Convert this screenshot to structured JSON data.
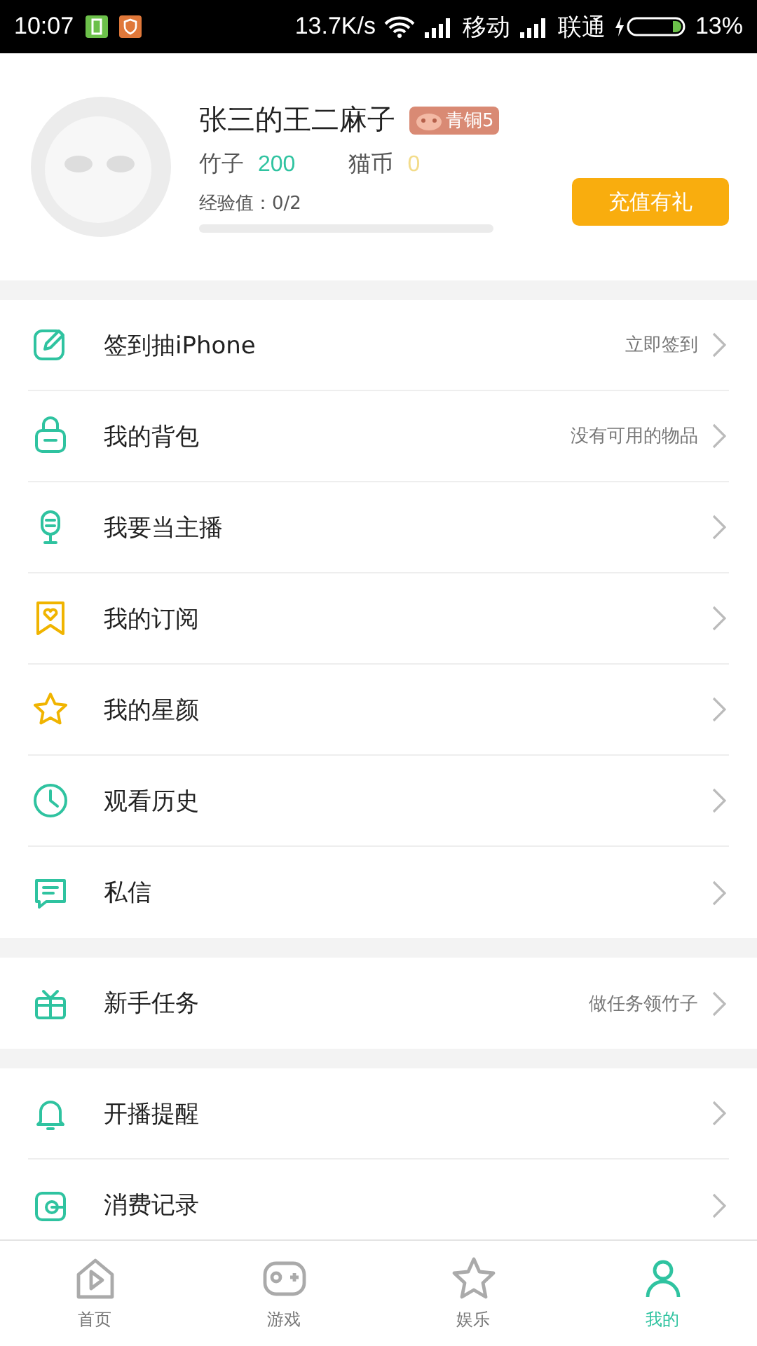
{
  "status_bar": {
    "time": "10:07",
    "speed": "13.7K/s",
    "carrier_1": "移动",
    "carrier_2": "联通",
    "battery": "13%"
  },
  "profile": {
    "name": "张三的王二麻子",
    "badge": "青铜5",
    "stats": [
      {
        "label": "竹子",
        "value": "200",
        "kind": "bamboo"
      },
      {
        "label": "猫币",
        "value": "0",
        "kind": "coin"
      }
    ],
    "experience": {
      "label": "经验值：0/2",
      "level": 0
    },
    "recharge_button": "充值有礼"
  },
  "menu_groups": [
    {
      "items": [
        {
          "label": "签到抽iPhone",
          "detail": "立即签到"
        },
        {
          "label": "我的背包",
          "detail": "没有可用的物品"
        },
        {
          "label": "我要当主播"
        },
        {
          "label": "我的订阅"
        },
        {
          "label": "我的星颜"
        },
        {
          "label": "观看历史"
        },
        {
          "label": "私信"
        }
      ]
    },
    {
      "items": [
        {
          "label": "新手任务",
          "detail": "做任务领竹子"
        }
      ]
    },
    {
      "items": [
        {
          "label": "开播提醒"
        },
        {
          "label": "消费记录"
        }
      ]
    }
  ],
  "tab_bar": [
    {
      "label": "首页",
      "selected": false
    },
    {
      "label": "游戏",
      "selected": false
    },
    {
      "label": "娱乐",
      "selected": false
    },
    {
      "label": "我的",
      "selected": true
    }
  ]
}
